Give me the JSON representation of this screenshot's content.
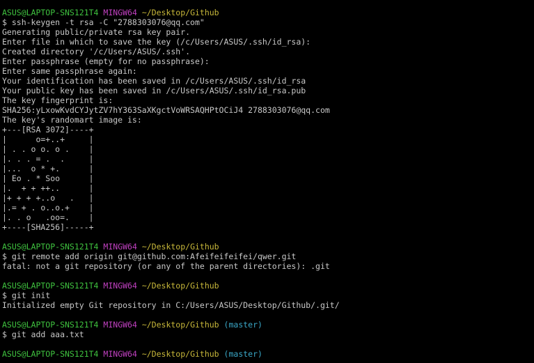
{
  "window": {
    "type": "terminal",
    "background": "#000000"
  },
  "colors": {
    "user": "#3fc23f",
    "system": "#c040c0",
    "path": "#c8b83a",
    "branch": "#3aa8c8",
    "text": "#c8c8c8"
  },
  "lines": [
    [
      [
        "ASUS@LAPTOP-SNS121T4",
        "user"
      ],
      [
        " ",
        "text"
      ],
      [
        "MINGW64",
        "sys"
      ],
      [
        " ",
        "text"
      ],
      [
        "~/Desktop/Github",
        "path"
      ]
    ],
    [
      [
        "$ ssh-keygen -t rsa -C \"2788303076@qq.com\"",
        "text"
      ]
    ],
    [
      [
        "Generating public/private rsa key pair.",
        "text"
      ]
    ],
    [
      [
        "Enter file in which to save the key (/c/Users/ASUS/.ssh/id_rsa):",
        "text"
      ]
    ],
    [
      [
        "Created directory '/c/Users/ASUS/.ssh'.",
        "text"
      ]
    ],
    [
      [
        "Enter passphrase (empty for no passphrase):",
        "text"
      ]
    ],
    [
      [
        "Enter same passphrase again:",
        "text"
      ]
    ],
    [
      [
        "Your identification has been saved in /c/Users/ASUS/.ssh/id_rsa",
        "text"
      ]
    ],
    [
      [
        "Your public key has been saved in /c/Users/ASUS/.ssh/id_rsa.pub",
        "text"
      ]
    ],
    [
      [
        "The key fingerprint is:",
        "text"
      ]
    ],
    [
      [
        "SHA256:yLxowKvdCYJytZV7hY363SaXKgctVoWRSAQHPtOCiJ4 2788303076@qq.com",
        "text"
      ]
    ],
    [
      [
        "The key's randomart image is:",
        "text"
      ]
    ],
    [
      [
        "+---[RSA 3072]----+",
        "text"
      ]
    ],
    [
      [
        "|      o=+..+     |",
        "text"
      ]
    ],
    [
      [
        "| . . o o. o .    |",
        "text"
      ]
    ],
    [
      [
        "|. . . = .  .     |",
        "text"
      ]
    ],
    [
      [
        "|...  o * +.      |",
        "text"
      ]
    ],
    [
      [
        "| Eo . * Soo      |",
        "text"
      ]
    ],
    [
      [
        "|.  + + ++..      |",
        "text"
      ]
    ],
    [
      [
        "|+ + + +..o   .   |",
        "text"
      ]
    ],
    [
      [
        "|.= + . o..o.+    |",
        "text"
      ]
    ],
    [
      [
        "|. . o   .oo=.    |",
        "text"
      ]
    ],
    [
      [
        "+----[SHA256]-----+",
        "text"
      ]
    ],
    [
      [
        "",
        "text"
      ]
    ],
    [
      [
        "ASUS@LAPTOP-SNS121T4",
        "user"
      ],
      [
        " ",
        "text"
      ],
      [
        "MINGW64",
        "sys"
      ],
      [
        " ",
        "text"
      ],
      [
        "~/Desktop/Github",
        "path"
      ]
    ],
    [
      [
        "$ git remote add origin git@github.com:Afeifeifeifei/qwer.git",
        "text"
      ]
    ],
    [
      [
        "fatal: not a git repository (or any of the parent directories): .git",
        "text"
      ]
    ],
    [
      [
        "",
        "text"
      ]
    ],
    [
      [
        "ASUS@LAPTOP-SNS121T4",
        "user"
      ],
      [
        " ",
        "text"
      ],
      [
        "MINGW64",
        "sys"
      ],
      [
        " ",
        "text"
      ],
      [
        "~/Desktop/Github",
        "path"
      ]
    ],
    [
      [
        "$ git init",
        "text"
      ]
    ],
    [
      [
        "Initialized empty Git repository in C:/Users/ASUS/Desktop/Github/.git/",
        "text"
      ]
    ],
    [
      [
        "",
        "text"
      ]
    ],
    [
      [
        "ASUS@LAPTOP-SNS121T4",
        "user"
      ],
      [
        " ",
        "text"
      ],
      [
        "MINGW64",
        "sys"
      ],
      [
        " ",
        "text"
      ],
      [
        "~/Desktop/Github",
        "path"
      ],
      [
        " ",
        "text"
      ],
      [
        "(master)",
        "branch"
      ]
    ],
    [
      [
        "$ git add aaa.txt",
        "text"
      ]
    ],
    [
      [
        "",
        "text"
      ]
    ],
    [
      [
        "ASUS@LAPTOP-SNS121T4",
        "user"
      ],
      [
        " ",
        "text"
      ],
      [
        "MINGW64",
        "sys"
      ],
      [
        " ",
        "text"
      ],
      [
        "~/Desktop/Github",
        "path"
      ],
      [
        " ",
        "text"
      ],
      [
        "(master)",
        "branch"
      ]
    ]
  ]
}
